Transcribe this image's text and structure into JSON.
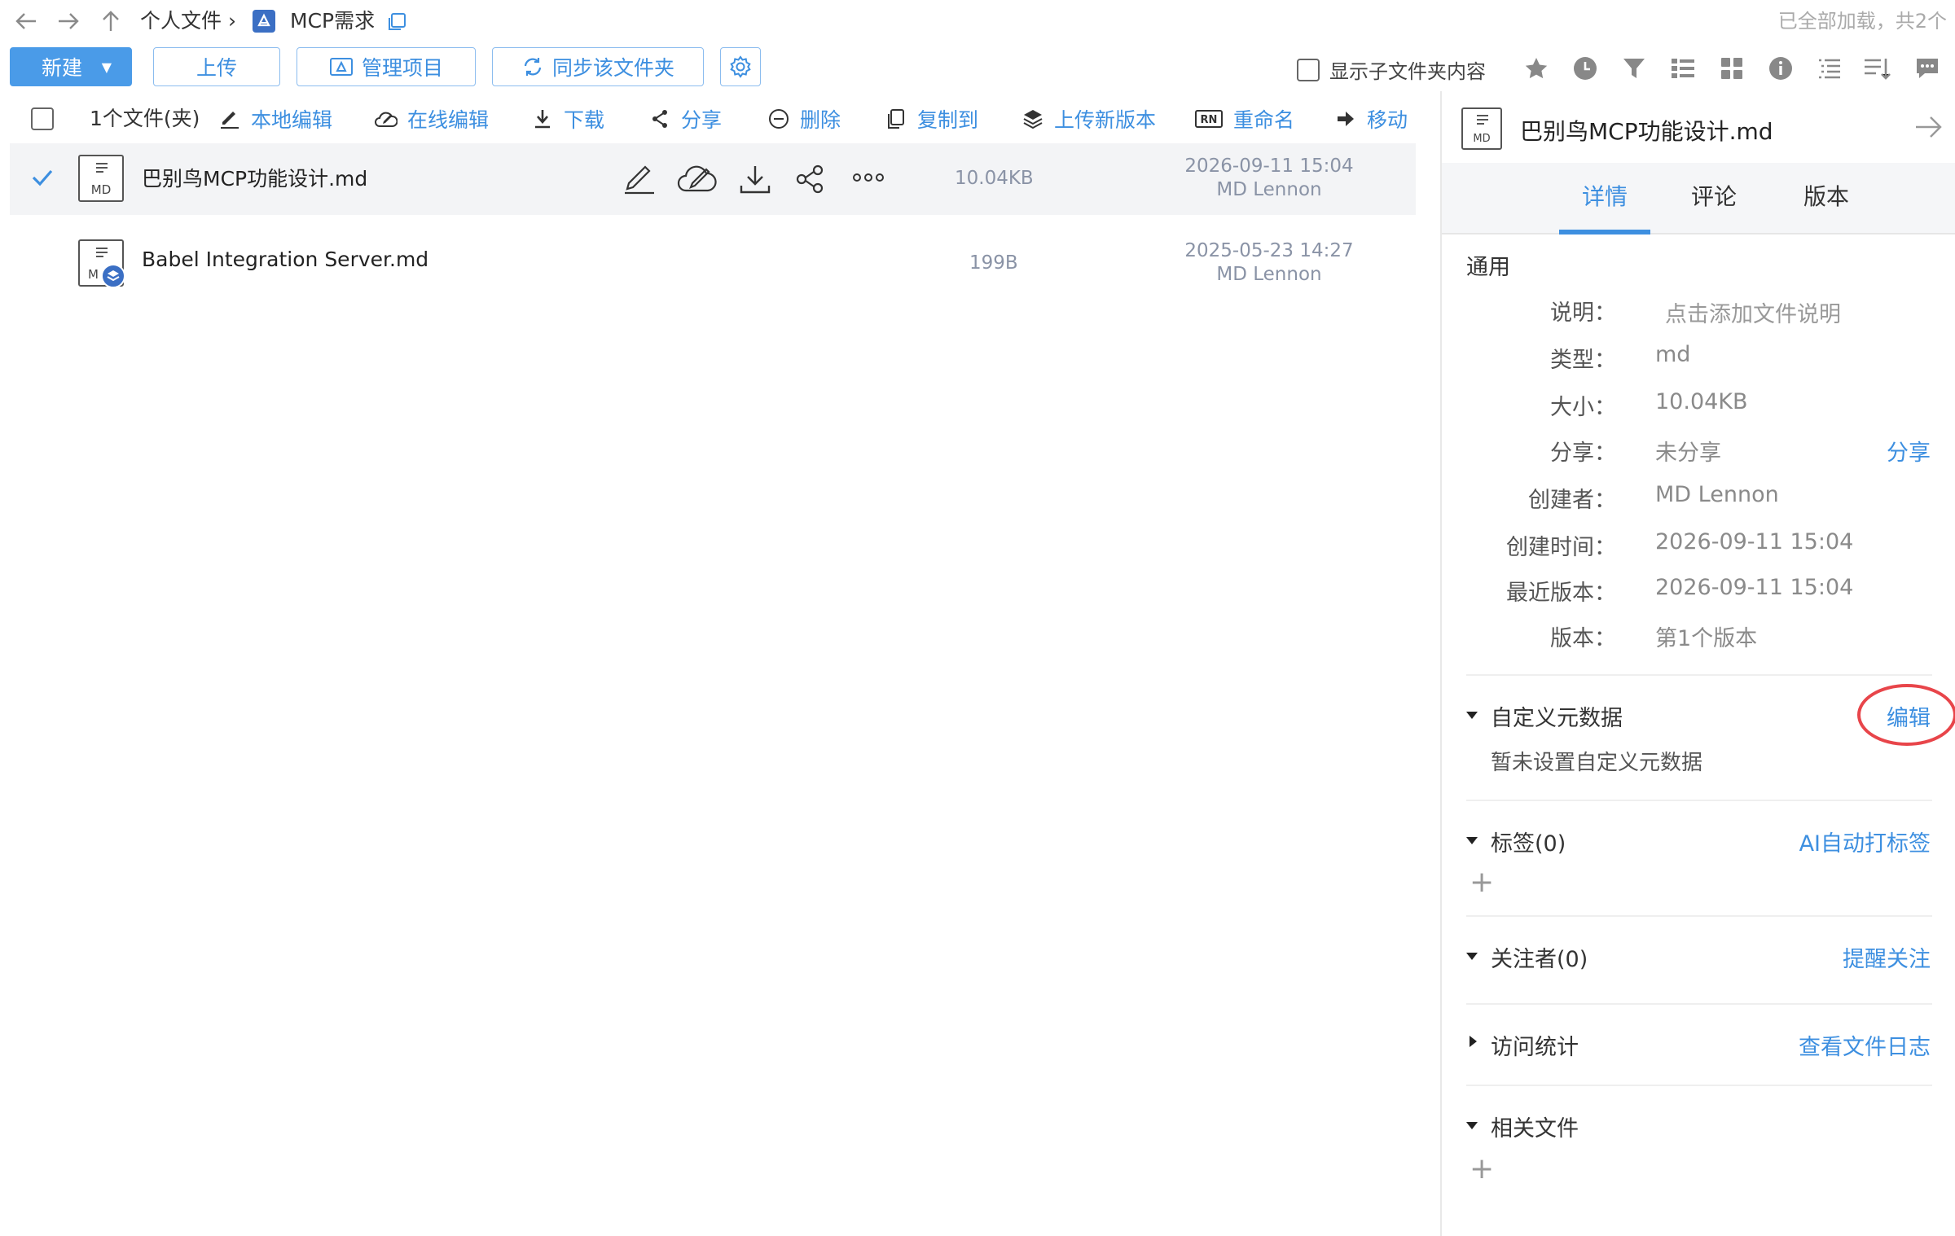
{
  "breadcrumb": {
    "root": "个人文件 ›",
    "folder": "MCP需求"
  },
  "load_status": "已全部加载，共2个",
  "toolbar": {
    "new_label": "新建",
    "upload_label": "上传",
    "manage_label": "管理项目",
    "sync_label": "同步该文件夹",
    "show_subfolder_label": "显示子文件夹内容"
  },
  "actions": {
    "selection_count": "1个文件(夹)",
    "local_edit": "本地编辑",
    "online_edit": "在线编辑",
    "download": "下载",
    "share": "分享",
    "delete": "删除",
    "copy_to": "复制到",
    "upload_new_version": "上传新版本",
    "rename": "重命名",
    "move": "移动"
  },
  "files": [
    {
      "name": "巴别鸟MCP功能设计.md",
      "ext": "MD",
      "size": "10.04KB",
      "date": "2026-09-11 15:04",
      "owner": "MD Lennon",
      "selected": true
    },
    {
      "name": "Babel Integration Server.md",
      "ext": "M",
      "size": "199B",
      "date": "2025-05-23 14:27",
      "owner": "MD Lennon",
      "selected": false
    }
  ],
  "panel": {
    "file_name": "巴别鸟MCP功能设计.md",
    "file_ext": "MD",
    "tabs": [
      "详情",
      "评论",
      "版本"
    ],
    "active_tab": "详情",
    "general_title": "通用",
    "fields": [
      {
        "label": "说明：",
        "value": "点击添加文件说明"
      },
      {
        "label": "类型：",
        "value": "md"
      },
      {
        "label": "大小：",
        "value": "10.04KB"
      },
      {
        "label": "分享：",
        "value": "未分享"
      },
      {
        "label": "创建者：",
        "value": "MD Lennon"
      },
      {
        "label": "创建时间：",
        "value": "2026-09-11 15:04"
      },
      {
        "label": "最近版本：",
        "value": "2026-09-11 15:04"
      },
      {
        "label": "版本：",
        "value": "第1个版本"
      }
    ],
    "share_link": "分享",
    "custom_meta": {
      "title": "自定义元数据",
      "action": "编辑",
      "empty": "暂未设置自定义元数据"
    },
    "tags": {
      "title": "标签(0)",
      "action": "AI自动打标签"
    },
    "followers": {
      "title": "关注者(0)",
      "action": "提醒关注"
    },
    "stats": {
      "title": "访问统计",
      "action": "查看文件日志"
    },
    "related": {
      "title": "相关文件"
    }
  },
  "colors": {
    "accent": "#3d8fe0",
    "primary_button": "#4a9be8",
    "highlight_circle": "#e8454a"
  }
}
